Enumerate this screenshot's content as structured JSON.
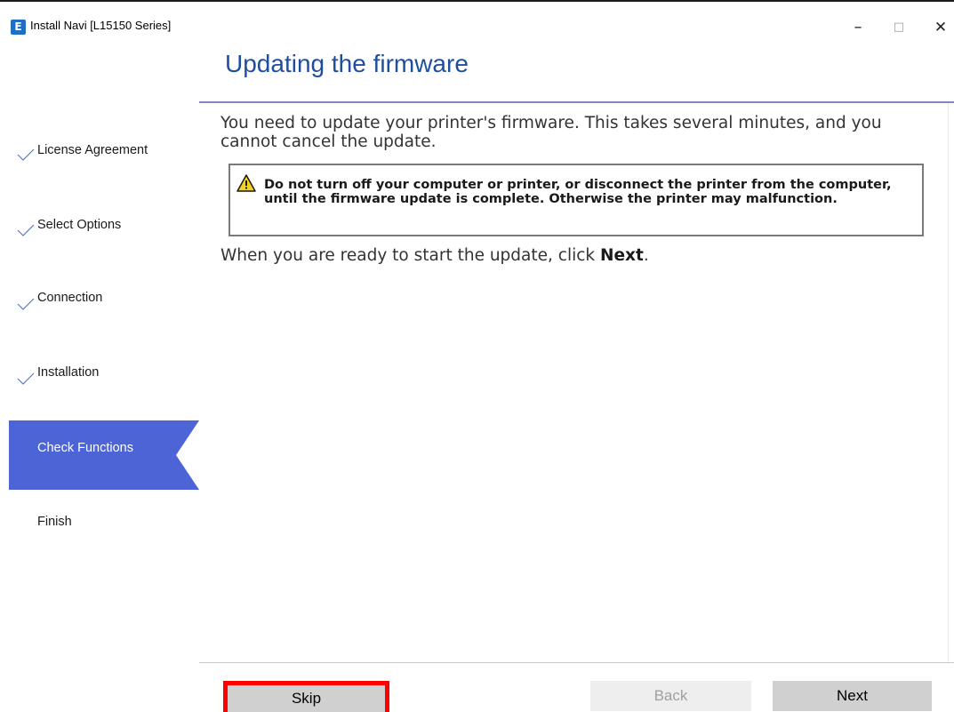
{
  "window": {
    "title": "Install Navi [L15150 Series]",
    "icon_letter": "E",
    "controls": {
      "minimize": "–",
      "maximize": "□",
      "close": "✕"
    }
  },
  "sidebar": {
    "steps": [
      {
        "label": "License Agreement",
        "completed": true
      },
      {
        "label": "Select Options",
        "completed": true
      },
      {
        "label": "Connection",
        "completed": true
      },
      {
        "label": "Installation",
        "completed": true
      },
      {
        "label": "Check Functions",
        "completed": false,
        "active": true
      },
      {
        "label": "Finish",
        "completed": false
      }
    ],
    "active_color": "#4c64d6"
  },
  "main": {
    "title": "Updating the firmware",
    "intro": "You need to update your printer's firmware. This takes several minutes, and you cannot cancel the update.",
    "warning": "Do not turn off your computer or printer, or disconnect the printer from the computer, until the firmware update is complete. Otherwise the printer may malfunction.",
    "ready_prefix": "When you are ready to start the update, click ",
    "ready_bold": "Next",
    "ready_suffix": "."
  },
  "buttons": {
    "skip": "Skip",
    "back": "Back",
    "next": "Next"
  },
  "colors": {
    "title": "#1e4f9e",
    "highlight_border": "#ff0000"
  }
}
